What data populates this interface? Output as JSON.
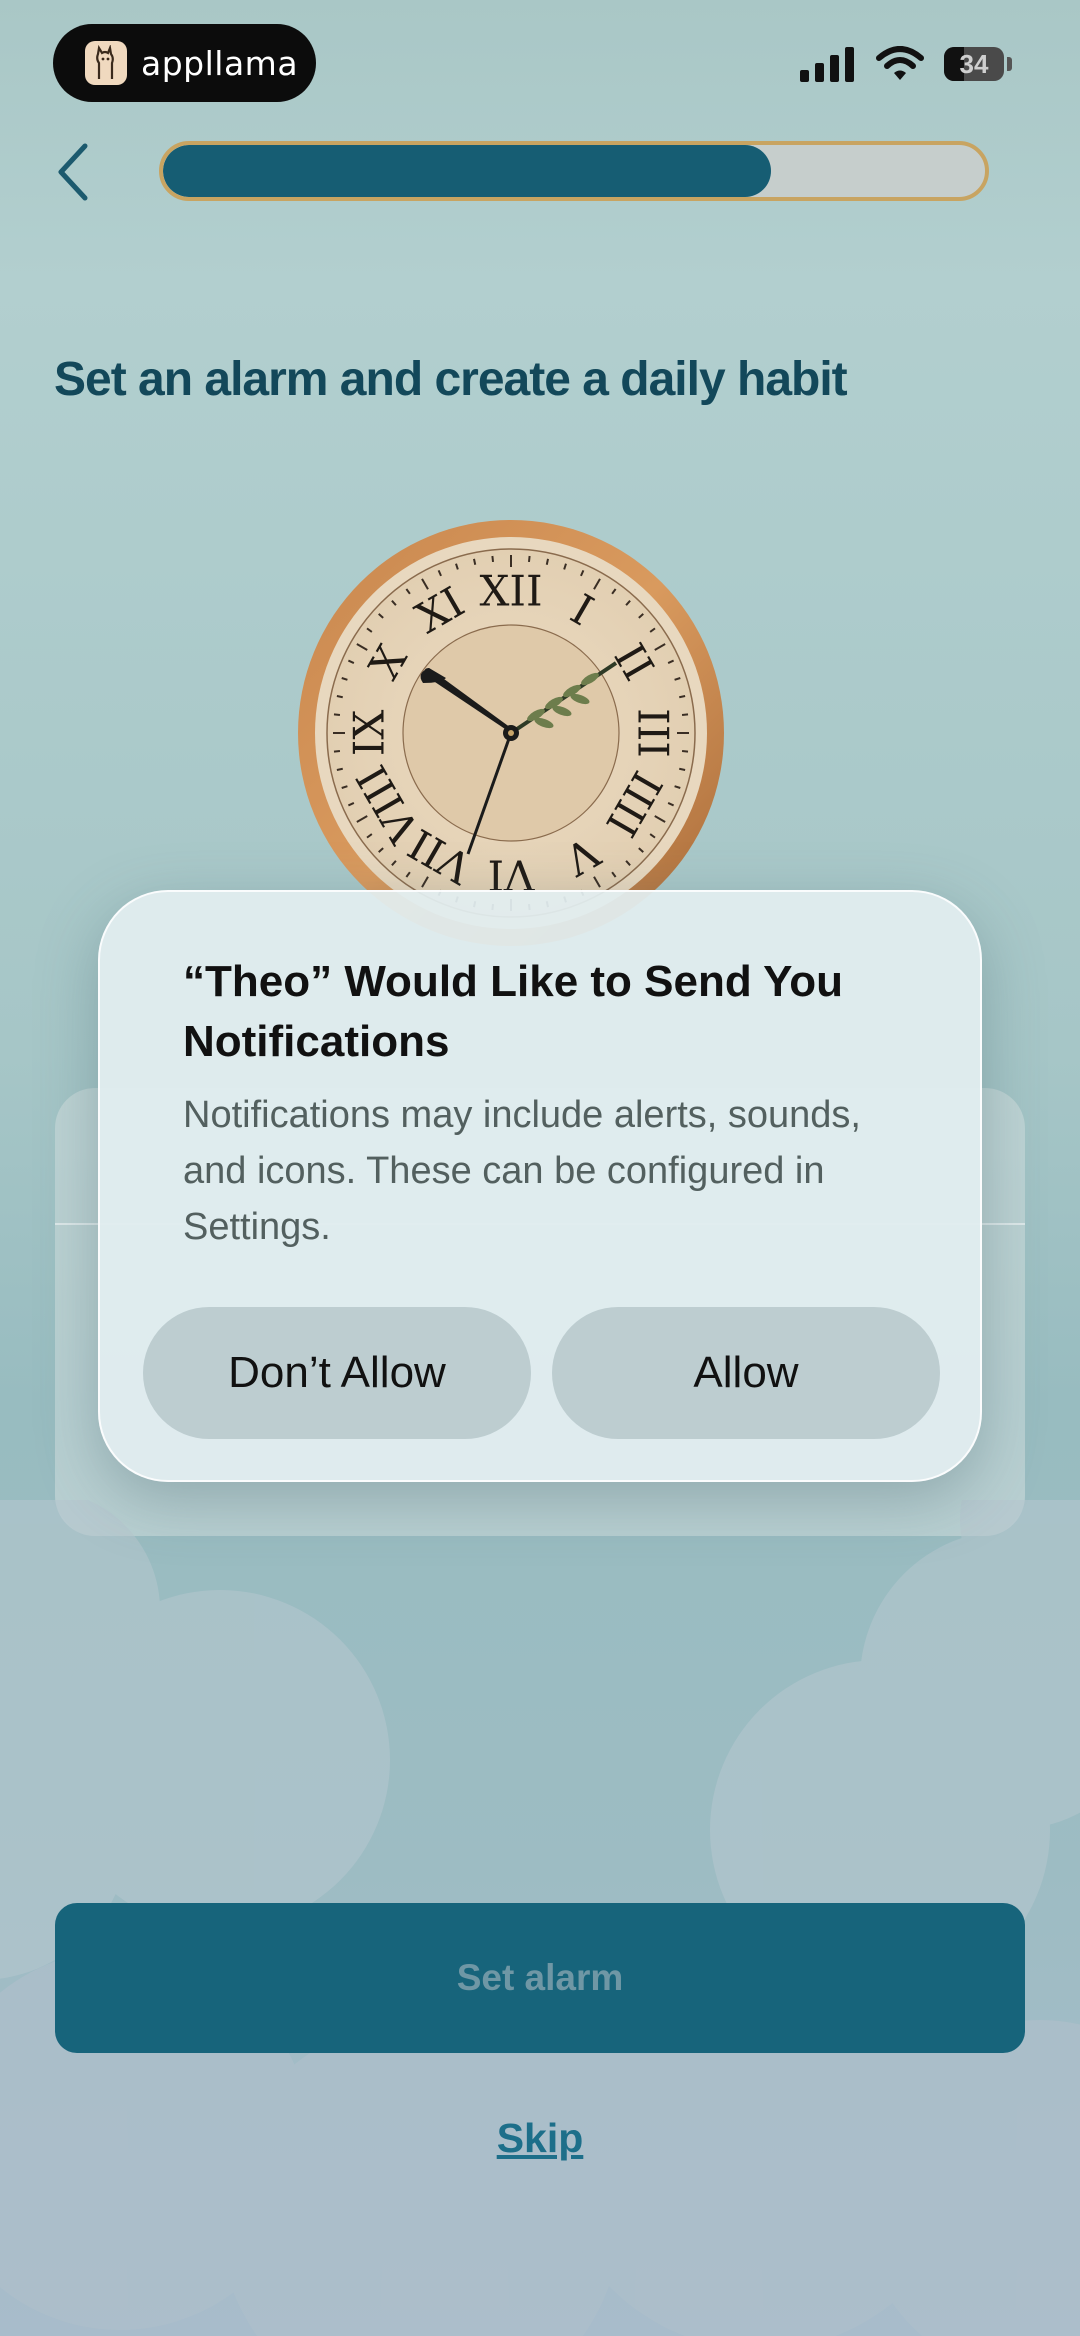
{
  "status_bar": {
    "brand_name": "appllama",
    "battery": "34"
  },
  "header": {
    "progress": 0.74
  },
  "page": {
    "title": "Set an alarm and create a daily habit"
  },
  "dialog": {
    "title": "“Theo” Would Like to Send You Notifications",
    "body": "Notifications may include alerts, sounds, and icons. These can be configured in Settings.",
    "dont_allow_label": "Don’t Allow",
    "allow_label": "Allow"
  },
  "footer": {
    "primary_label": "Set alarm",
    "skip_label": "Skip"
  },
  "colors": {
    "accent": "#165d73",
    "progress_border": "#c8a461",
    "title": "#13485a"
  }
}
